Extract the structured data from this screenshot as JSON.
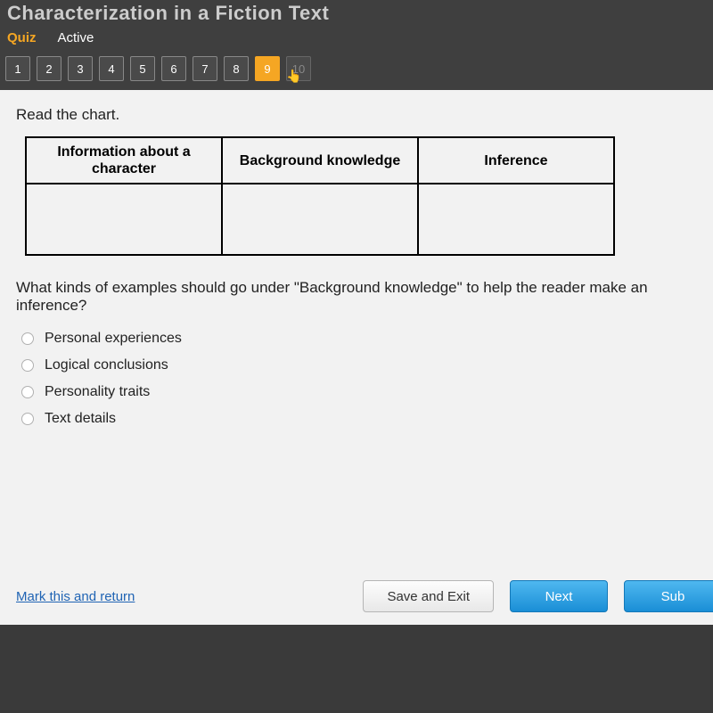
{
  "header": {
    "title": "Characterization in a Fiction Text",
    "tab_quiz": "Quiz",
    "tab_active": "Active"
  },
  "nav": {
    "items": [
      "1",
      "2",
      "3",
      "4",
      "5",
      "6",
      "7",
      "8",
      "9",
      "10"
    ],
    "current_index": 8,
    "disabled_index": 9
  },
  "content": {
    "instruction": "Read the chart.",
    "table": {
      "headers": [
        "Information about a character",
        "Background knowledge",
        "Inference"
      ]
    },
    "question": "What kinds of examples should go under \"Background knowledge\" to help the reader make an inference?",
    "options": [
      "Personal experiences",
      "Logical conclusions",
      "Personality traits",
      "Text details"
    ]
  },
  "footer": {
    "mark_link": "Mark this and return",
    "save_exit": "Save and Exit",
    "next": "Next",
    "submit": "Sub"
  }
}
